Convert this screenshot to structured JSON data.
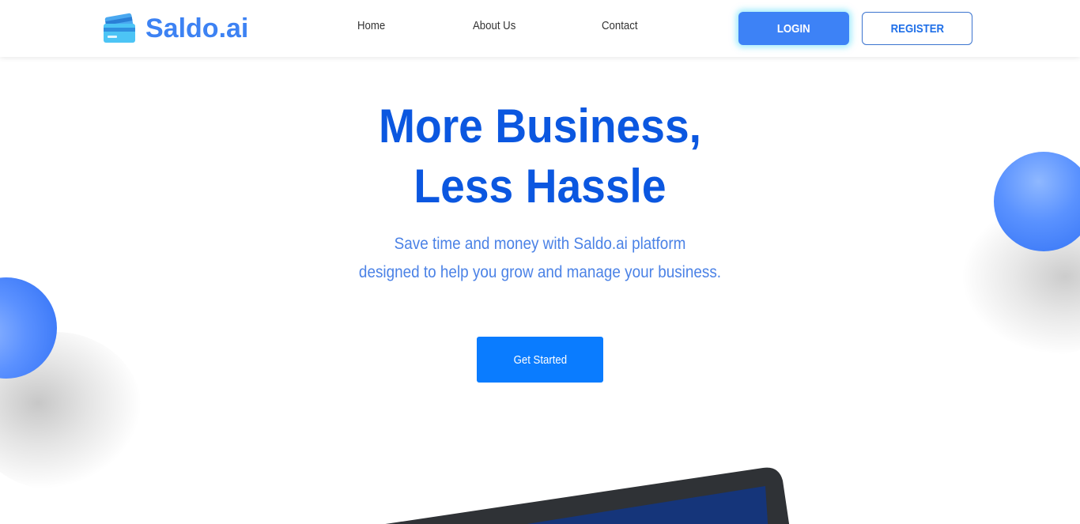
{
  "brand": {
    "name": "Saldo.ai",
    "icon": "credit-card-icon",
    "color": "#3d82f3"
  },
  "nav": {
    "items": [
      {
        "label": "Home"
      },
      {
        "label": "About Us"
      },
      {
        "label": "Contact"
      }
    ],
    "login_label": "LOGIN",
    "register_label": "REGISTER"
  },
  "hero": {
    "title_line1": "More Business,",
    "title_line2": "Less Hassle",
    "subtitle_line1": "Save time and money with Saldo.ai platform",
    "subtitle_line2": "designed to help you grow and manage your business.",
    "cta_label": "Get Started"
  },
  "colors": {
    "primary": "#0b57e0",
    "accent": "#0a7cff",
    "subtitle": "#4b82e6",
    "login_bg": "#3d82f6",
    "login_glow": "#54dcfa"
  }
}
